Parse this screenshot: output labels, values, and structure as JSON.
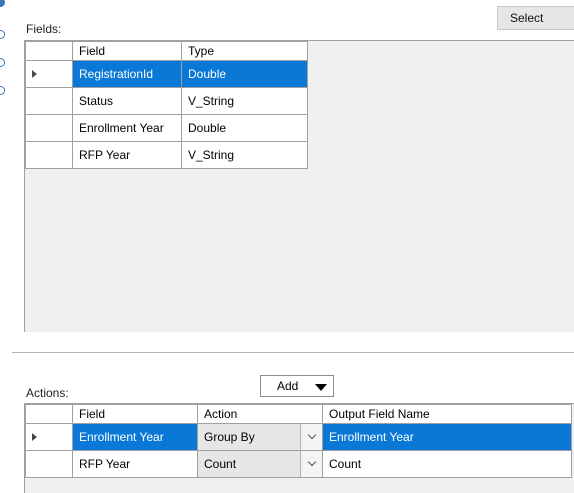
{
  "fields_label": "Fields:",
  "select_button": "Select",
  "fields_table": {
    "headers": [
      "Field",
      "Type"
    ],
    "rows": [
      {
        "field": "RegistrationId",
        "type": "Double",
        "selected": true
      },
      {
        "field": "Status",
        "type": "V_String",
        "selected": false
      },
      {
        "field": "Enrollment Year",
        "type": "Double",
        "selected": false
      },
      {
        "field": "RFP Year",
        "type": "V_String",
        "selected": false
      }
    ]
  },
  "actions_label": "Actions:",
  "add_dropdown": "Add",
  "actions_table": {
    "headers": [
      "Field",
      "Action",
      "Output Field Name"
    ],
    "rows": [
      {
        "field": "Enrollment Year",
        "action": "Group By",
        "output": "Enrollment Year",
        "selected": true
      },
      {
        "field": "RFP Year",
        "action": "Count",
        "output": "Count",
        "selected": false
      }
    ]
  },
  "colors": {
    "selection": "#0a78d7",
    "panel_bg": "#f0f0f0",
    "icon_blue": "#3a73b6"
  }
}
